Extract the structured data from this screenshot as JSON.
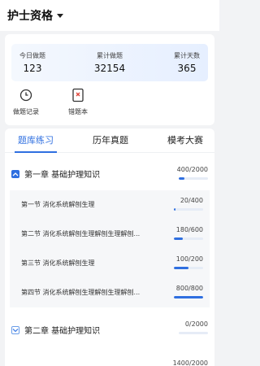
{
  "header": {
    "title": "护士资格"
  },
  "stats": [
    {
      "label": "今日做题",
      "value": "123"
    },
    {
      "label": "累计做题",
      "value": "32154"
    },
    {
      "label": "累计天数",
      "value": "365"
    }
  ],
  "tools": [
    {
      "label": "做题记录",
      "icon": "clock-icon"
    },
    {
      "label": "错题本",
      "icon": "wrong-book-icon"
    }
  ],
  "tabs": [
    {
      "label": "题库练习",
      "active": true
    },
    {
      "label": "历年真题",
      "active": false
    },
    {
      "label": "模考大赛",
      "active": false
    }
  ],
  "chapters": [
    {
      "title": "第一章 基础护理知识",
      "count": "400/2000",
      "progress": 0.2,
      "expanded": true,
      "sections": [
        {
          "title": "第一节 消化系统解刨生理",
          "count": "20/400",
          "progress": 0.05
        },
        {
          "title": "第二节 消化系统解刨生理解刨生理解刨...",
          "count": "180/600",
          "progress": 0.3
        },
        {
          "title": "第三节 消化系统解刨生理",
          "count": "100/200",
          "progress": 0.5
        },
        {
          "title": "第四节 消化系统解刨生理解刨生理解刨...",
          "count": "800/800",
          "progress": 1.0
        }
      ]
    },
    {
      "title": "第二章 基础护理知识",
      "count": "0/2000",
      "progress": 0,
      "expanded": false,
      "sections": []
    }
  ],
  "partial_next_count": "1400/2000",
  "colors": {
    "accent": "#2f6fe0",
    "background": "#f2f3f5"
  }
}
